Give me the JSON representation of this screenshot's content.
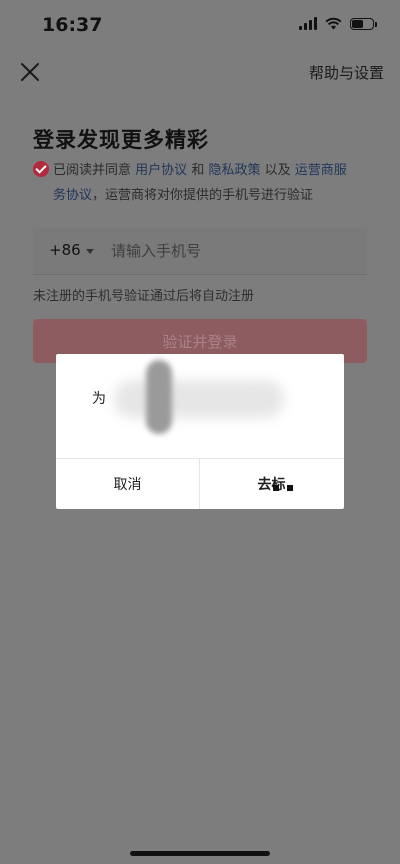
{
  "status": {
    "time": "16:37"
  },
  "header": {
    "close_icon": "close-icon",
    "help_label": "帮助与设置"
  },
  "page": {
    "title": "登录发现更多精彩",
    "agreement": {
      "prefix": "已阅读并同意",
      "user_agreement": "用户协议",
      "and": "和",
      "privacy_policy": "隐私政策",
      "also": "以及",
      "carrier_terms_1": "运营商服",
      "carrier_terms_2": "务协议",
      "suffix": "，运营商将对你提供的手机号进行验证"
    },
    "country_code": "+86",
    "phone_placeholder": "请输入手机号",
    "auto_register_notice": "未注册的手机号验证通过后将自动注册",
    "verify_button": "验证并登录"
  },
  "dialog": {
    "message": "为",
    "cancel_label": "取消",
    "confirm_label": "去标"
  },
  "colors": {
    "accent": "#b32a3c",
    "link": "#22365a",
    "overlay": "#7d7d7d"
  }
}
